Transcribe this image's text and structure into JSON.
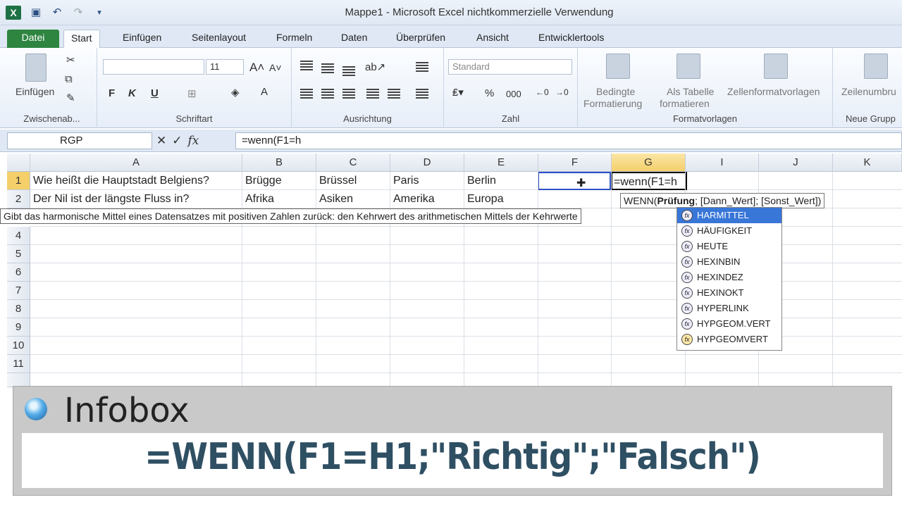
{
  "window": {
    "title": "Mappe1  -  Microsoft Excel nichtkommerzielle Verwendung",
    "app_icon": "X"
  },
  "tabs": [
    "Datei",
    "Start",
    "Einfügen",
    "Seitenlayout",
    "Formeln",
    "Daten",
    "Überprüfen",
    "Ansicht",
    "Entwicklertools"
  ],
  "ribbon": {
    "clipboard": {
      "paste_label": "Einfügen",
      "group_label": "Zwischenab..."
    },
    "font": {
      "size": "11",
      "bold": "F",
      "italic": "K",
      "underline": "U",
      "group_label": "Schriftart"
    },
    "alignment": {
      "group_label": "Ausrichtung"
    },
    "number": {
      "format": "Standard",
      "percent": "%",
      "thousands": "000",
      "group_label": "Zahl"
    },
    "styles": {
      "conditional": "Bedingte",
      "conditional2": "Formatierung",
      "as_table": "Als Tabelle",
      "as_table2": "formatieren",
      "cell_styles": "Zellenformatvorlagen",
      "group_label": "Formatvorlagen"
    },
    "cells": {
      "wrap": "Zeilenumbru",
      "group_label": "Neue Grupp"
    }
  },
  "formula_bar": {
    "name_box": "RGP",
    "formula": "=wenn(F1=h"
  },
  "columns": [
    "A",
    "B",
    "C",
    "D",
    "E",
    "F",
    "G",
    "I",
    "J",
    "K"
  ],
  "rows": [
    {
      "num": "1",
      "cells": [
        "Wie heißt die Hauptstadt Belgiens?",
        "Brügge",
        "Brüssel",
        "Paris",
        "Berlin",
        "",
        "=wenn(F1=h"
      ]
    },
    {
      "num": "2",
      "cells": [
        "Der Nil ist der längste Fluss in?",
        "Afrika",
        "Asiken",
        "Amerika",
        "Europa",
        "",
        ""
      ]
    },
    {
      "num": "4"
    },
    {
      "num": "5"
    },
    {
      "num": "6"
    },
    {
      "num": "7"
    },
    {
      "num": "8"
    },
    {
      "num": "9"
    },
    {
      "num": "10"
    },
    {
      "num": "11"
    }
  ],
  "function_tooltip": {
    "prefix": "WENN(",
    "bold_arg": "Prüfung",
    "rest": "; [Dann_Wert]; [Sonst_Wert])"
  },
  "description_tooltip": "Gibt das harmonische Mittel eines Datensatzes mit positiven Zahlen zurück: den Kehrwert des arithmetischen Mittels der Kehrwerte",
  "autocomplete": [
    "HARMITTEL",
    "HÄUFIGKEIT",
    "HEUTE",
    "HEXINBIN",
    "HEXINDEZ",
    "HEXINOKT",
    "HYPERLINK",
    "HYPGEOM.VERT",
    "HYPGEOMVERT"
  ],
  "infobox": {
    "title": "Infobox",
    "formula": "=WENN(F1=H1;\"Richtig\";\"Falsch\")"
  }
}
